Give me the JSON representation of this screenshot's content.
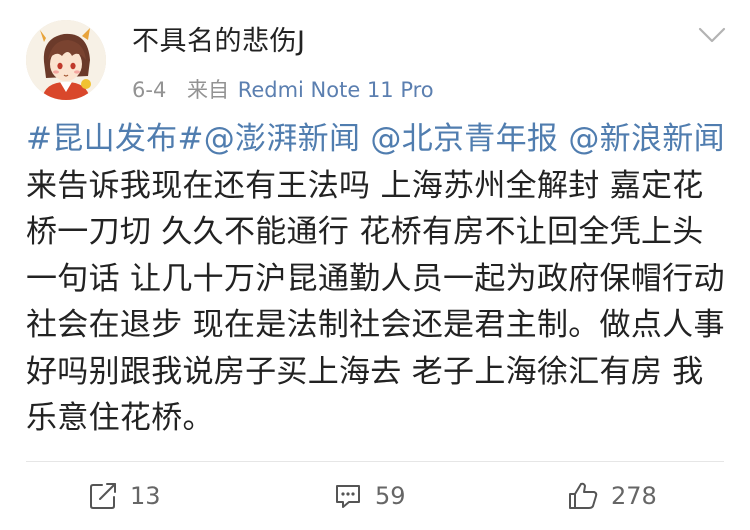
{
  "post": {
    "username": "不具名的悲伤J",
    "date": "6-4",
    "source_prefix": "来自",
    "device": "Redmi Note 11 Pro",
    "content": {
      "hashtag_1": "#昆山发布#",
      "mention_1": "@澎湃新闻",
      "mention_2": "@北京青年报",
      "mention_3": "@新浪新闻",
      "body": "来告诉我现在还有王法吗 上海苏州全解封 嘉定花桥一刀切 久久不能通行 花桥有房不让回全凭上头一句话 让几十万沪昆通勤人员一起为政府保帽行动 社会在退步 现在是法制社会还是君主制。做点人事好吗别跟我说房子买上海去 老子上海徐汇有房 我乐意住花桥。"
    },
    "icons": {
      "avatar": "anime-avatar",
      "menu": "chevron-down-icon",
      "repost": "repost-icon",
      "comment": "comment-icon",
      "like": "thumbs-up-icon"
    }
  },
  "actions": {
    "repost_count": "13",
    "comment_count": "59",
    "like_count": "278"
  },
  "colors": {
    "link": "#507daf",
    "device": "#5b7fb0",
    "meta": "#939393",
    "text": "#222222"
  }
}
